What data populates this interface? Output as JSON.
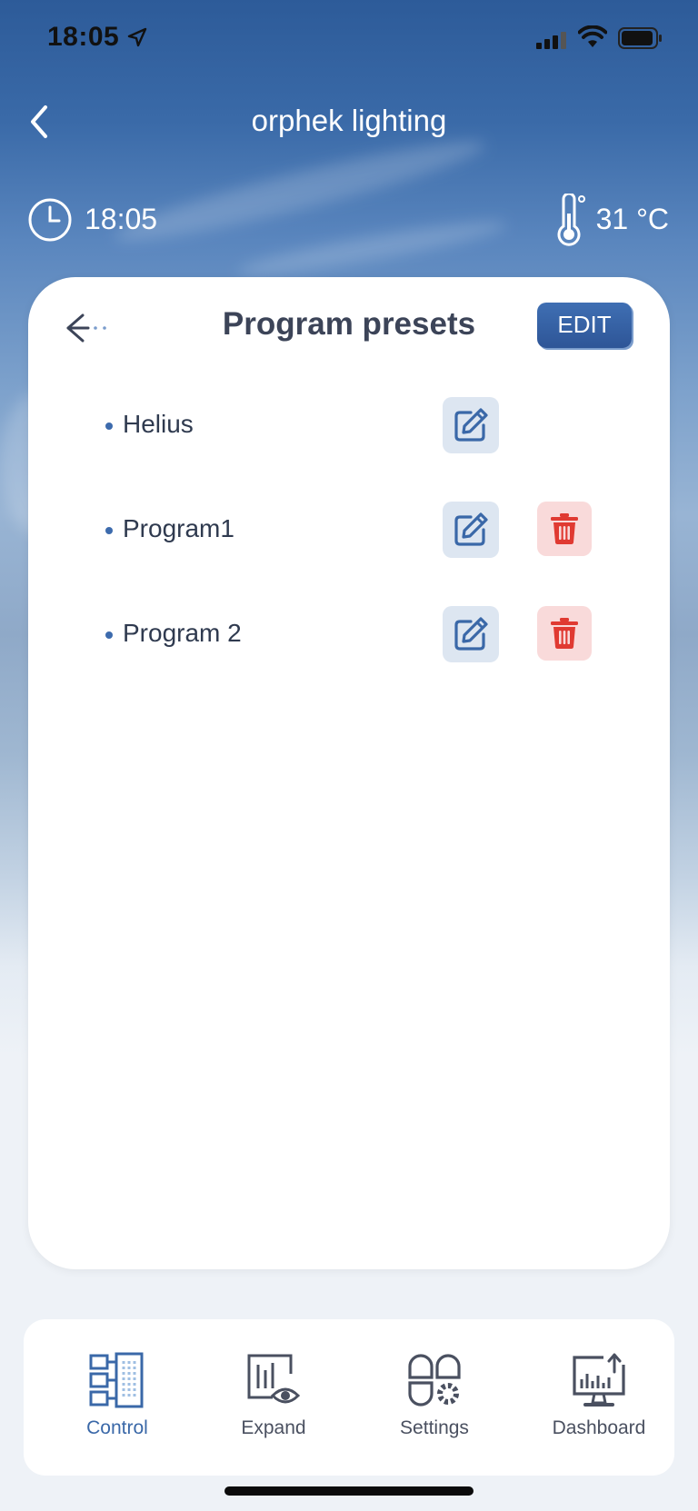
{
  "status_bar": {
    "time": "18:05"
  },
  "header": {
    "title": "orphek lighting",
    "clock_time": "18:05",
    "temperature": "31 °C"
  },
  "card": {
    "title": "Program presets",
    "edit_label": "EDIT",
    "presets": [
      {
        "name": "Helius",
        "deletable": false
      },
      {
        "name": "Program1",
        "deletable": true
      },
      {
        "name": "Program 2",
        "deletable": true
      }
    ]
  },
  "nav": {
    "items": [
      {
        "label": "Control",
        "icon": "control-icon",
        "active": true
      },
      {
        "label": "Expand",
        "icon": "expand-icon",
        "active": false
      },
      {
        "label": "Settings",
        "icon": "settings-icon",
        "active": false
      },
      {
        "label": "Dashboard",
        "icon": "dashboard-icon",
        "active": false
      }
    ]
  },
  "colors": {
    "accent": "#3a68a8",
    "delete": "#e03a32",
    "edit_bg": "#dde6f1",
    "delete_bg": "#f9dada"
  }
}
